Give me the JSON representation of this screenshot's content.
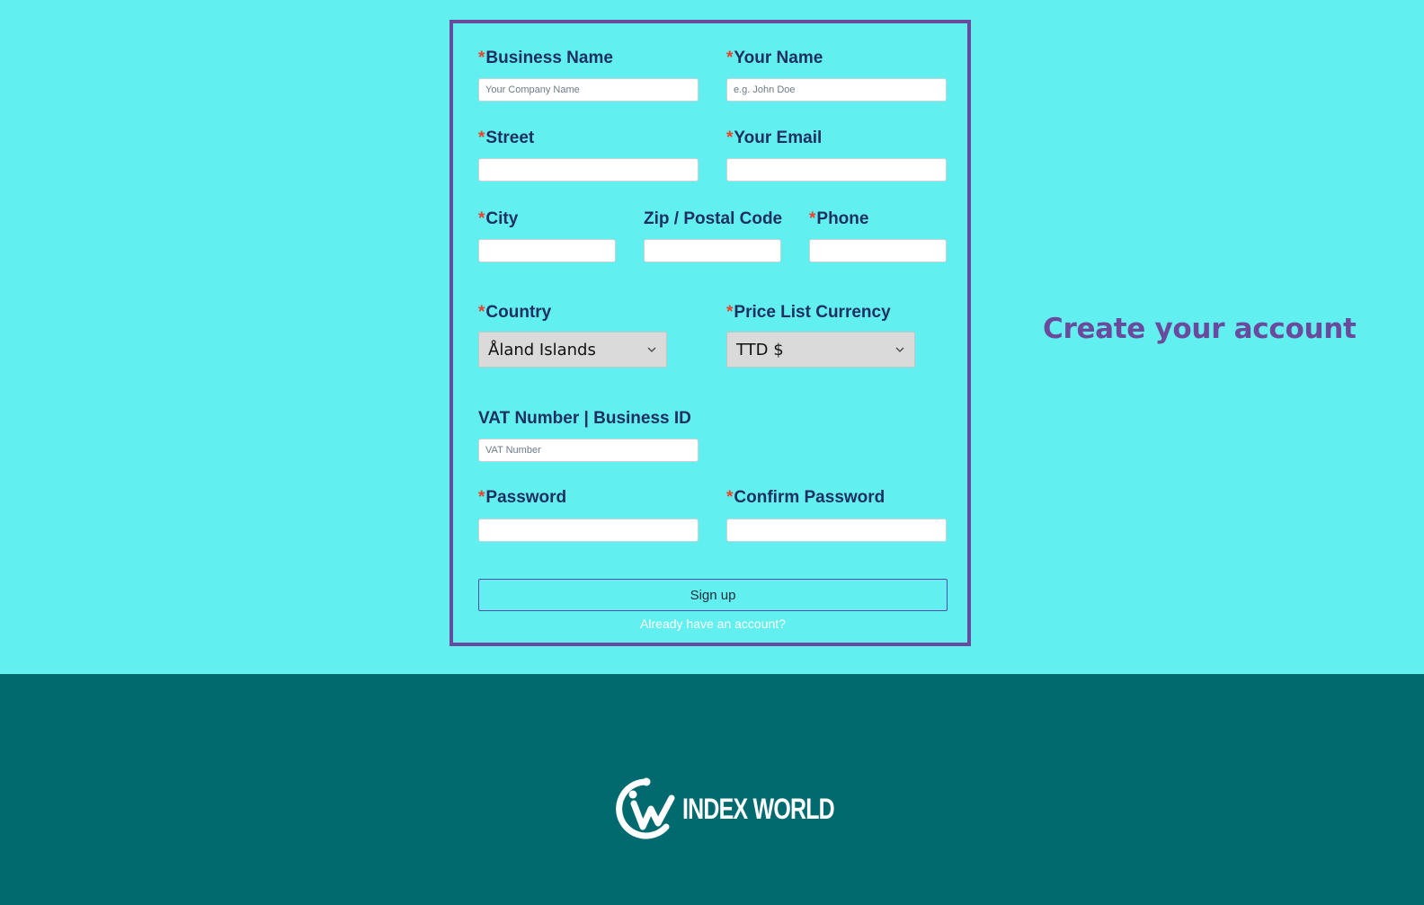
{
  "heading": "Create your account",
  "colors": {
    "page_background": "#62eff0",
    "form_border": "#6a4a9c",
    "label_text": "#1e3060",
    "required_marker": "#e8432a",
    "heading": "#6a4a9c",
    "footer_background": "#006a6e"
  },
  "form": {
    "required_marker": "*",
    "business_name": {
      "label": "Business Name",
      "placeholder": "Your Company Name",
      "value": ""
    },
    "your_name": {
      "label": "Your Name",
      "placeholder": "e.g. John Doe",
      "value": ""
    },
    "street": {
      "label": "Street",
      "placeholder": "",
      "value": ""
    },
    "your_email": {
      "label": "Your Email",
      "placeholder": "",
      "value": ""
    },
    "city": {
      "label": "City",
      "placeholder": "",
      "value": ""
    },
    "zip": {
      "label": "Zip / Postal Code",
      "placeholder": "",
      "value": ""
    },
    "phone": {
      "label": "Phone",
      "placeholder": "",
      "value": ""
    },
    "country": {
      "label": "Country",
      "selected": "Åland Islands"
    },
    "currency": {
      "label": "Price List Currency",
      "selected": "TTD $"
    },
    "vat": {
      "label": "VAT Number | Business ID",
      "placeholder": "VAT Number",
      "value": ""
    },
    "password": {
      "label": "Password",
      "placeholder": "",
      "value": ""
    },
    "confirm_password": {
      "label": "Confirm Password",
      "placeholder": "",
      "value": ""
    },
    "signup_label": "Sign up",
    "login_link_label": "Already have an account?"
  },
  "footer": {
    "logo_text": "INDEX WORLD",
    "logo_icon": "index-world-logo-icon"
  }
}
